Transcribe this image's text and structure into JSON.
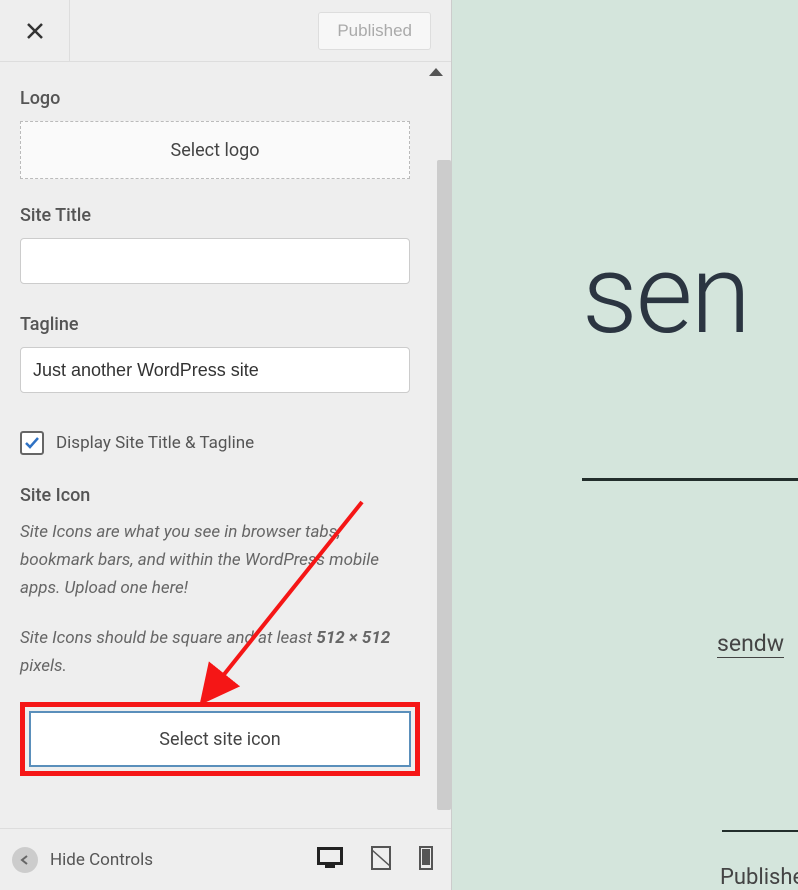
{
  "header": {
    "published_label": "Published"
  },
  "logo": {
    "label": "Logo",
    "button": "Select logo"
  },
  "site_title": {
    "label": "Site Title",
    "value": ""
  },
  "tagline": {
    "label": "Tagline",
    "value": "Just another WordPress site"
  },
  "display_toggle": {
    "label": "Display Site Title & Tagline",
    "checked": true
  },
  "site_icon": {
    "label": "Site Icon",
    "desc1_a": "Site Icons are what you see in browser tabs, bookmark bars, and within the WordPress mobile apps. Upload one here!",
    "desc2_a": "Site Icons should be square and at least ",
    "desc2_b": "512 × 512",
    "desc2_c": " pixels.",
    "button": "Select site icon"
  },
  "footer": {
    "hide_controls": "Hide Controls"
  },
  "preview": {
    "title_fragment": "sen",
    "link_fragment": "sendw",
    "published_fragment": "Publishe"
  }
}
